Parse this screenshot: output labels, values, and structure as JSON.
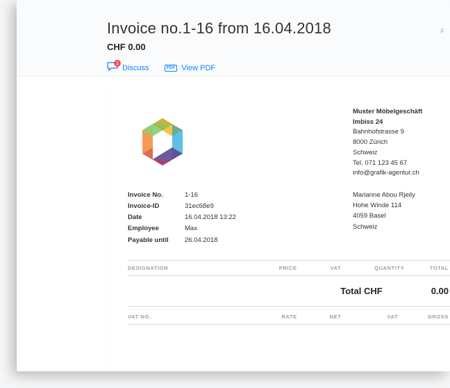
{
  "header": {
    "title": "Invoice no.1-16 from 16.04.2018",
    "amount": "CHF 0.00",
    "discuss_label": "Discuss",
    "discuss_badge": "1",
    "viewpdf_label": "View PDF",
    "pdf_icon_text": "PDF"
  },
  "company": {
    "name": "Muster Möbelgeschäft",
    "name2": "Imbiss 24",
    "street": "Bahnhofstrasse 9",
    "city": "8000 Zürich",
    "country": "Schweiz",
    "phone": "Tel. 071 123 45 67",
    "email": "info@grafik-agentur.ch"
  },
  "meta": {
    "labels": {
      "invoice_no": "Invoice No.",
      "invoice_id": "Invoice-ID",
      "date": "Date",
      "employee": "Employee",
      "payable_until": "Payable until"
    },
    "values": {
      "invoice_no": "1-16",
      "invoice_id": "31ec68e9",
      "date": "16.04.2018 13:22",
      "employee": "Max",
      "payable_until": "26.04.2018"
    }
  },
  "recipient": {
    "name": "Marianne Abou Rjeily",
    "street": "Hohe Winde 114",
    "city": "4059 Basel",
    "country": "Schweiz"
  },
  "table": {
    "headers": {
      "designation": "DESIGNATION",
      "price": "PRICE",
      "vat": "VAT",
      "quantity": "QUANTITY",
      "total": "TOTAL"
    },
    "total_label": "Total CHF",
    "total_value": "0.00"
  },
  "vat_table": {
    "headers": {
      "vat_no": "VAT NO.",
      "rate": "RATE",
      "net": "NET",
      "vat": "VAT",
      "gross": "GROSS"
    }
  }
}
